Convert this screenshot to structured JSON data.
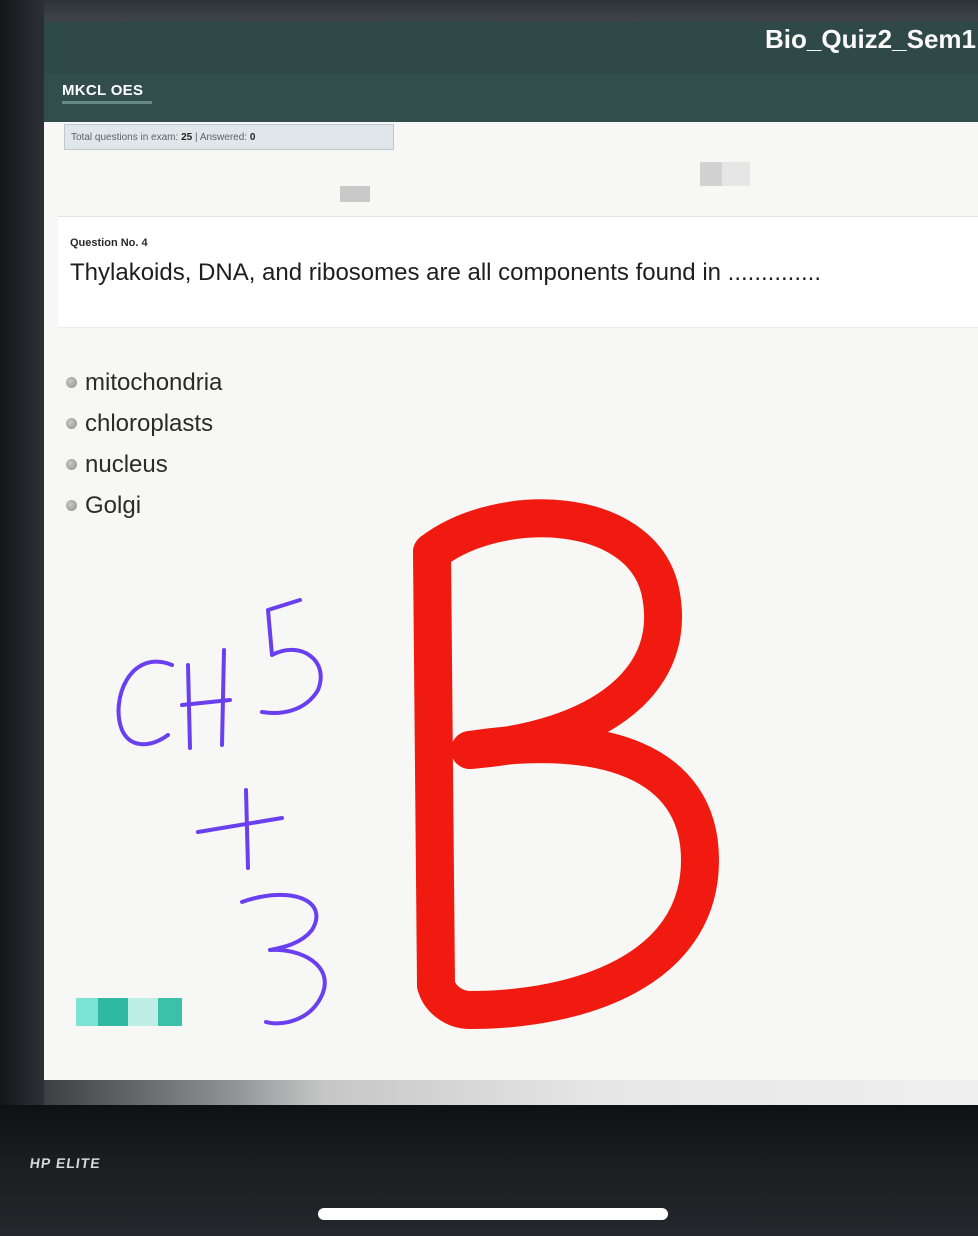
{
  "window": {
    "exam_title": "Bio_Quiz2_Sem1"
  },
  "header": {
    "brand": "MKCL OES"
  },
  "status": {
    "total_label": "Total questions in exam:",
    "total_value": "25",
    "separator": "|",
    "answered_label": "Answered:",
    "answered_value": "0"
  },
  "question": {
    "number_label": "Question No. 4",
    "text": "Thylakoids, DNA, and ribosomes are all components found in ..............",
    "options": [
      {
        "label": "mitochondria"
      },
      {
        "label": "chloroplasts"
      },
      {
        "label": "nucleus"
      },
      {
        "label": "Golgi"
      }
    ]
  },
  "annotations": {
    "handwritten_blue": "CH5 + 3",
    "handwritten_red": "B",
    "blue_color": "#6a3ff0",
    "red_color": "#f01a10"
  },
  "device": {
    "monitor_brand": "HP ELITE"
  },
  "colors": {
    "title_bar": "#2f4948",
    "accent_teal": "#3bbfa8"
  }
}
